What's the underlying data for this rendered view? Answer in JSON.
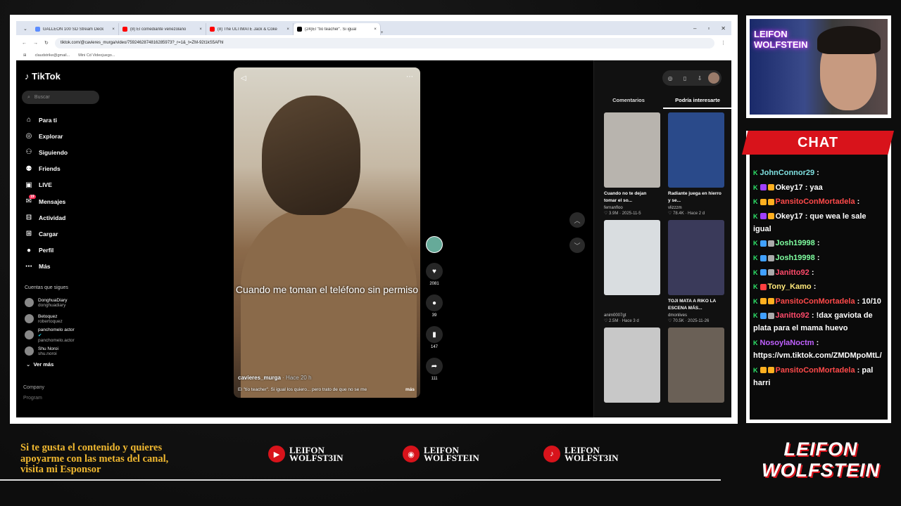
{
  "browser": {
    "tabs": [
      {
        "title": "GALLEON 100 SD Stream Deck",
        "fav": "#5b8cff",
        "active": false
      },
      {
        "title": "(8) El comediante venezolano",
        "fav": "#ff0000",
        "active": false
      },
      {
        "title": "(8) The ULTIMATE Jack & Coke",
        "fav": "#ff0000",
        "active": false
      },
      {
        "title": "(24)El \"tío teacher\". Si igual",
        "fav": "#000000",
        "active": true
      }
    ],
    "url": "tiktok.com/@cavieres_murga/video/7592462874816285973?_r=1&_t=ZM-92t1kS5AFhl",
    "bookmarks": [
      "claudstrike@gmail...",
      "Mini Cd Videojuego..."
    ]
  },
  "tiktok": {
    "logo": "TikTok",
    "search_placeholder": "Buscar",
    "nav": [
      {
        "icon": "home-icon",
        "glyph": "⌂",
        "label": "Para ti"
      },
      {
        "icon": "compass-icon",
        "glyph": "◎",
        "label": "Explorar"
      },
      {
        "icon": "following-icon",
        "glyph": "⚇",
        "label": "Siguiendo"
      },
      {
        "icon": "friends-icon",
        "glyph": "⚉",
        "label": "Friends"
      },
      {
        "icon": "live-icon",
        "glyph": "▣",
        "label": "LIVE"
      },
      {
        "icon": "messages-icon",
        "glyph": "✉",
        "label": "Mensajes",
        "badge": "19"
      },
      {
        "icon": "activity-icon",
        "glyph": "⊟",
        "label": "Actividad"
      },
      {
        "icon": "upload-icon",
        "glyph": "⊞",
        "label": "Cargar"
      },
      {
        "icon": "profile-icon",
        "glyph": "●",
        "label": "Perfil"
      },
      {
        "icon": "more-icon",
        "glyph": "⋯",
        "label": "Más"
      }
    ],
    "following_header": "Cuentas que sigues",
    "following": [
      {
        "name": "DonghuaDiary",
        "handle": "donghuadiary"
      },
      {
        "name": "Betoquez",
        "handle": "robertoquez"
      },
      {
        "name": "panchomelo actor",
        "handle": "panchomelo.actor",
        "verified": true
      },
      {
        "name": "Shu Noroi",
        "handle": "shu.noroi"
      }
    ],
    "ver_mas": "Ver más",
    "company": "Company",
    "program": "Program",
    "video": {
      "caption": "Cuando me toman el teléfono sin permiso",
      "author": "cavieres_murga",
      "time": "· Hace 20 h",
      "desc": "El \"tío teacher\". Si igual los quiero... pero trato de que no se me",
      "more": "más"
    },
    "actions": {
      "likes": "2081",
      "comments": "39",
      "saves": "147",
      "shares": "111"
    },
    "right_tabs": [
      "Comentarios",
      "Podría interesarte"
    ],
    "suggestions": [
      {
        "title": "Cuando no te dejan tomar el so...",
        "author": "fernanfloo",
        "meta": "♡ 3.9M · 2025-11-5",
        "color": "#b8b4ae"
      },
      {
        "title": "Radiante juega en hierro y se...",
        "author": "vlizzzm",
        "meta": "♡ 78.4K · Hace 2 d",
        "color": "#2a4a8a"
      },
      {
        "title": "",
        "author": "anim0007gt",
        "meta": "♡ 2.5M · Hace 3 d",
        "color": "#d9dde0"
      },
      {
        "title": "TOJI MATA A RIKO LA ESCENA MÁS...",
        "author": "dmonlives",
        "meta": "♡ 70.5K · 2025-11-26",
        "color": "#3a3a5a"
      },
      {
        "title": "",
        "author": "",
        "meta": "",
        "color": "#c8c8c8"
      },
      {
        "title": "",
        "author": "",
        "meta": "",
        "color": "#6a6056"
      }
    ]
  },
  "webcam": {
    "neon": "LEIFON WOLFSTEIN"
  },
  "chat": {
    "title": "CHAT",
    "messages": [
      {
        "user": "JohnConnor29",
        "cls": "u1",
        "text": " :",
        "badges": []
      },
      {
        "user": "Okey17",
        "cls": "u2",
        "text": " : yaa",
        "badges": [
          "#a040ff",
          "#ffb020"
        ]
      },
      {
        "user": "PansitoConMortadela",
        "cls": "u3",
        "text": " :",
        "badges": [
          "#ffb020",
          "#ffb020"
        ]
      },
      {
        "user": "Okey17",
        "cls": "u2",
        "text": " : que wea le sale igual",
        "badges": [
          "#a040ff",
          "#ffb020"
        ]
      },
      {
        "user": "Josh19998",
        "cls": "u4",
        "text": " :",
        "badges": [
          "#40a0ff",
          "#aaa"
        ]
      },
      {
        "user": "Josh19998",
        "cls": "u4",
        "text": " :",
        "badges": [
          "#40a0ff",
          "#aaa"
        ]
      },
      {
        "user": "Janitto92",
        "cls": "u5",
        "text": " :",
        "badges": [
          "#40a0ff",
          "#aaa"
        ]
      },
      {
        "user": "Tony_Kamo",
        "cls": "u6",
        "text": " :",
        "badges": [
          "#ff4040"
        ]
      },
      {
        "user": "PansitoConMortadela",
        "cls": "u3",
        "text": " : 10/10",
        "badges": [
          "#ffb020",
          "#ffb020"
        ]
      },
      {
        "user": "Janitto92",
        "cls": "u5",
        "text": " : !dax gaviota de plata para el mama huevo",
        "badges": [
          "#40a0ff",
          "#aaa"
        ]
      },
      {
        "user": "NosoylaNoctm",
        "cls": "u7",
        "text": " : https://vm.tiktok.com/ZMDMpoMtL/",
        "badges": []
      },
      {
        "user": "PansitoConMortadela",
        "cls": "u3",
        "text": " : pal harri",
        "badges": [
          "#ffb020",
          "#ffb020"
        ]
      }
    ]
  },
  "footer": {
    "promo": [
      "Si te gusta el contenido y quieres",
      "apoyarme con las metas del canal,",
      "visita mi Esponsor"
    ],
    "socials": [
      {
        "icon": "youtube-icon",
        "glyph": "▶",
        "l1": "LEIFON",
        "l2": "WOLFST3IN"
      },
      {
        "icon": "instagram-icon",
        "glyph": "◉",
        "l1": "LEIFON",
        "l2": "WOLFSTEIN"
      },
      {
        "icon": "tiktok-icon",
        "glyph": "♪",
        "l1": "LEIFON",
        "l2": "WOLFST3IN"
      }
    ],
    "brand": [
      "LEIFON",
      "WOLFSTEIN"
    ]
  }
}
